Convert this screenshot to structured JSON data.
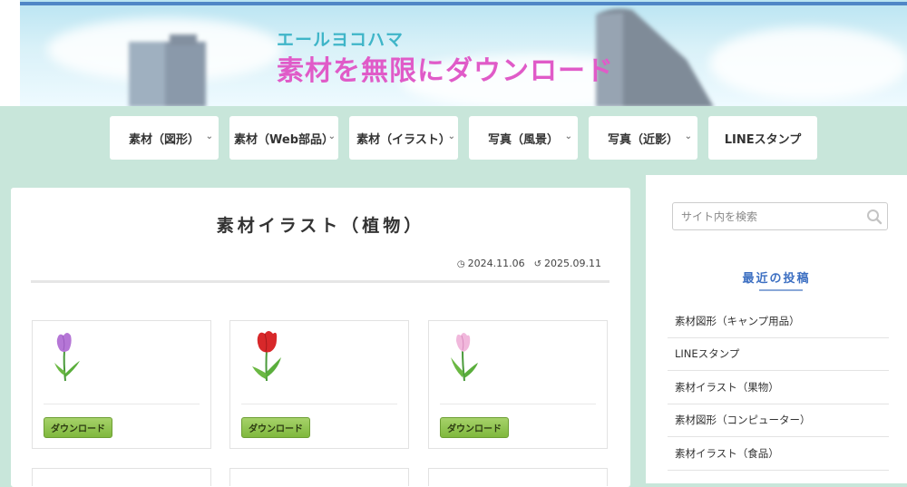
{
  "header": {
    "subtitle": "エールヨコハマ",
    "title": "素材を無限にダウンロード"
  },
  "nav": {
    "items": [
      {
        "label": "素材（図形）",
        "has_dropdown": true
      },
      {
        "label": "素材（Web部品）",
        "has_dropdown": true
      },
      {
        "label": "素材（イラスト）",
        "has_dropdown": true
      },
      {
        "label": "写真（風景）",
        "has_dropdown": true
      },
      {
        "label": "写真（近影）",
        "has_dropdown": true
      },
      {
        "label": "LINEスタンプ",
        "has_dropdown": false
      }
    ]
  },
  "post": {
    "title": "素材イラスト（植物）",
    "published": "2024.11.06",
    "updated": "2025.09.11",
    "items": [
      {
        "icon": "purple-tulip-icon",
        "button_label": "ダウンロード"
      },
      {
        "icon": "red-tulip-icon",
        "button_label": "ダウンロード"
      },
      {
        "icon": "pink-tulip-icon",
        "button_label": "ダウンロード"
      }
    ]
  },
  "sidebar": {
    "search_placeholder": "サイト内を検索",
    "recent_title": "最近の投稿",
    "recent_posts": [
      "素材図形（キャンプ用品）",
      "LINEスタンプ",
      "素材イラスト（果物）",
      "素材図形（コンピューター）",
      "素材イラスト（食品）"
    ]
  },
  "colors": {
    "background": "#c8e6da",
    "banner_subtitle": "#3fb5c8",
    "banner_title": "#e05bc8",
    "accent_blue": "#3c6fc2",
    "button_green": "#8fc44f"
  }
}
